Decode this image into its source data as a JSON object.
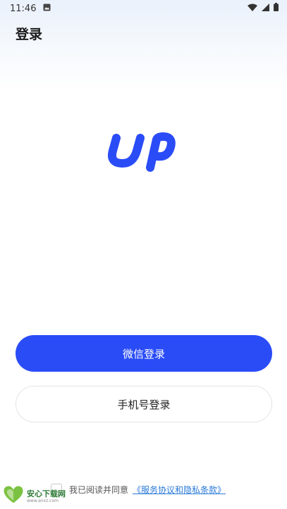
{
  "status_bar": {
    "time": "11:46",
    "notification_icon": "image-notification-icon",
    "wifi_icon": "wifi-icon",
    "signal_icon": "cell-signal-icon",
    "battery_icon": "battery-icon"
  },
  "header": {
    "title": "登录"
  },
  "logo": {
    "icon": "up-logo",
    "color": "#2a4cf7"
  },
  "buttons": {
    "wechat_login": "微信登录",
    "phone_login": "手机号登录"
  },
  "agreement": {
    "prefix": "我已阅读并同意",
    "link": "《服务协议和隐私条款》"
  },
  "watermark": {
    "name": "安心下载网",
    "url": "www.anxz.com"
  },
  "colors": {
    "primary": "#2a4cf7",
    "link": "#2a7ad8"
  }
}
